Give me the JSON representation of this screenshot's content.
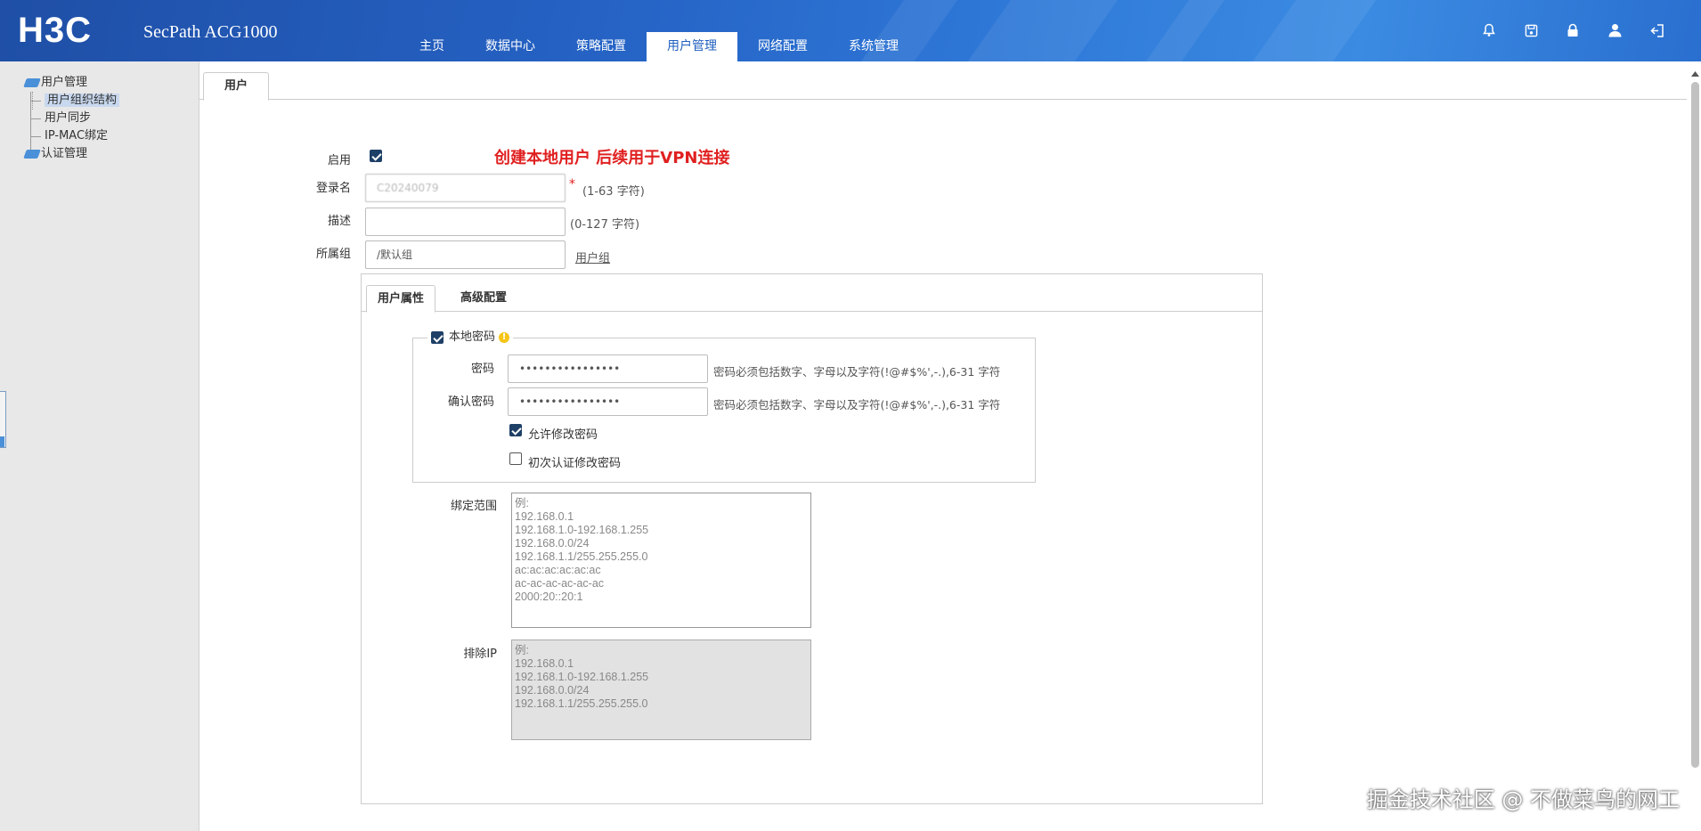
{
  "header": {
    "logo": "H3C",
    "product": "SecPath ACG1000",
    "nav": [
      "主页",
      "数据中心",
      "策略配置",
      "用户管理",
      "网络配置",
      "系统管理"
    ],
    "active_nav": "用户管理",
    "icons": [
      "bell-icon",
      "save-icon",
      "lock-icon",
      "user-icon",
      "logout-icon"
    ]
  },
  "sidebar": {
    "tree": [
      {
        "label": "用户管理",
        "level": 1
      },
      {
        "label": "用户组织结构",
        "level": 2,
        "selected": true
      },
      {
        "label": "用户同步",
        "level": 2
      },
      {
        "label": "IP-MAC绑定",
        "level": 2
      },
      {
        "label": "认证管理",
        "level": 1
      }
    ]
  },
  "page_tab": "用户",
  "annotation": "创建本地用户 后续用于VPN连接",
  "form": {
    "enable_label": "启用",
    "enable_checked": true,
    "login_label": "登录名",
    "login_value": "C20240079",
    "login_required": "*",
    "login_hint": "(1-63 字符)",
    "desc_label": "描述",
    "desc_value": "",
    "desc_hint": "(0-127 字符)",
    "group_label": "所属组",
    "group_value": "/默认组",
    "group_link": "用户组"
  },
  "subtabs": {
    "items": [
      "用户属性",
      "高级配置"
    ],
    "active": "用户属性"
  },
  "password_box": {
    "legend": "本地密码",
    "legend_checked": true,
    "password_label": "密码",
    "password_value": "••••••••••••••••",
    "password_hint": "密码必须包括数字、字母以及字符(!@#$%',-.),6-31 字符",
    "confirm_label": "确认密码",
    "confirm_value": "••••••••••••••••",
    "confirm_hint": "密码必须包括数字、字母以及字符(!@#$%',-.),6-31 字符",
    "allow_change_label": "允许修改密码",
    "allow_change_checked": true,
    "first_login_label": "初次认证修改密码",
    "first_login_checked": false
  },
  "bind": {
    "label": "绑定范围",
    "placeholder": "例:\n192.168.0.1\n192.168.1.0-192.168.1.255\n192.168.0.0/24\n192.168.1.1/255.255.255.0\nac:ac:ac:ac:ac:ac\nac-ac-ac-ac-ac-ac\n2000:20::20:1"
  },
  "exclude": {
    "label": "排除IP",
    "placeholder": "例:\n192.168.0.1\n192.168.1.0-192.168.1.255\n192.168.0.0/24\n192.168.1.1/255.255.255.0"
  },
  "watermark": "掘金技术社区 @ 不做菜鸟的网工",
  "colors": {
    "header_blue": "#2562c4",
    "annotation_red": "#e02020",
    "checkbox": "#1e3f66"
  }
}
